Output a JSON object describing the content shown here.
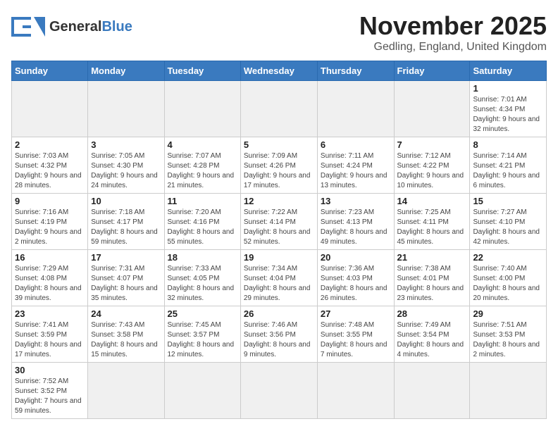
{
  "header": {
    "logo_general": "General",
    "logo_blue": "Blue",
    "month_title": "November 2025",
    "location": "Gedling, England, United Kingdom"
  },
  "weekdays": [
    "Sunday",
    "Monday",
    "Tuesday",
    "Wednesday",
    "Thursday",
    "Friday",
    "Saturday"
  ],
  "weeks": [
    [
      {
        "day": "",
        "info": ""
      },
      {
        "day": "",
        "info": ""
      },
      {
        "day": "",
        "info": ""
      },
      {
        "day": "",
        "info": ""
      },
      {
        "day": "",
        "info": ""
      },
      {
        "day": "",
        "info": ""
      },
      {
        "day": "1",
        "info": "Sunrise: 7:01 AM\nSunset: 4:34 PM\nDaylight: 9 hours and 32 minutes."
      }
    ],
    [
      {
        "day": "2",
        "info": "Sunrise: 7:03 AM\nSunset: 4:32 PM\nDaylight: 9 hours and 28 minutes."
      },
      {
        "day": "3",
        "info": "Sunrise: 7:05 AM\nSunset: 4:30 PM\nDaylight: 9 hours and 24 minutes."
      },
      {
        "day": "4",
        "info": "Sunrise: 7:07 AM\nSunset: 4:28 PM\nDaylight: 9 hours and 21 minutes."
      },
      {
        "day": "5",
        "info": "Sunrise: 7:09 AM\nSunset: 4:26 PM\nDaylight: 9 hours and 17 minutes."
      },
      {
        "day": "6",
        "info": "Sunrise: 7:11 AM\nSunset: 4:24 PM\nDaylight: 9 hours and 13 minutes."
      },
      {
        "day": "7",
        "info": "Sunrise: 7:12 AM\nSunset: 4:22 PM\nDaylight: 9 hours and 10 minutes."
      },
      {
        "day": "8",
        "info": "Sunrise: 7:14 AM\nSunset: 4:21 PM\nDaylight: 9 hours and 6 minutes."
      }
    ],
    [
      {
        "day": "9",
        "info": "Sunrise: 7:16 AM\nSunset: 4:19 PM\nDaylight: 9 hours and 2 minutes."
      },
      {
        "day": "10",
        "info": "Sunrise: 7:18 AM\nSunset: 4:17 PM\nDaylight: 8 hours and 59 minutes."
      },
      {
        "day": "11",
        "info": "Sunrise: 7:20 AM\nSunset: 4:16 PM\nDaylight: 8 hours and 55 minutes."
      },
      {
        "day": "12",
        "info": "Sunrise: 7:22 AM\nSunset: 4:14 PM\nDaylight: 8 hours and 52 minutes."
      },
      {
        "day": "13",
        "info": "Sunrise: 7:23 AM\nSunset: 4:13 PM\nDaylight: 8 hours and 49 minutes."
      },
      {
        "day": "14",
        "info": "Sunrise: 7:25 AM\nSunset: 4:11 PM\nDaylight: 8 hours and 45 minutes."
      },
      {
        "day": "15",
        "info": "Sunrise: 7:27 AM\nSunset: 4:10 PM\nDaylight: 8 hours and 42 minutes."
      }
    ],
    [
      {
        "day": "16",
        "info": "Sunrise: 7:29 AM\nSunset: 4:08 PM\nDaylight: 8 hours and 39 minutes."
      },
      {
        "day": "17",
        "info": "Sunrise: 7:31 AM\nSunset: 4:07 PM\nDaylight: 8 hours and 35 minutes."
      },
      {
        "day": "18",
        "info": "Sunrise: 7:33 AM\nSunset: 4:05 PM\nDaylight: 8 hours and 32 minutes."
      },
      {
        "day": "19",
        "info": "Sunrise: 7:34 AM\nSunset: 4:04 PM\nDaylight: 8 hours and 29 minutes."
      },
      {
        "day": "20",
        "info": "Sunrise: 7:36 AM\nSunset: 4:03 PM\nDaylight: 8 hours and 26 minutes."
      },
      {
        "day": "21",
        "info": "Sunrise: 7:38 AM\nSunset: 4:01 PM\nDaylight: 8 hours and 23 minutes."
      },
      {
        "day": "22",
        "info": "Sunrise: 7:40 AM\nSunset: 4:00 PM\nDaylight: 8 hours and 20 minutes."
      }
    ],
    [
      {
        "day": "23",
        "info": "Sunrise: 7:41 AM\nSunset: 3:59 PM\nDaylight: 8 hours and 17 minutes."
      },
      {
        "day": "24",
        "info": "Sunrise: 7:43 AM\nSunset: 3:58 PM\nDaylight: 8 hours and 15 minutes."
      },
      {
        "day": "25",
        "info": "Sunrise: 7:45 AM\nSunset: 3:57 PM\nDaylight: 8 hours and 12 minutes."
      },
      {
        "day": "26",
        "info": "Sunrise: 7:46 AM\nSunset: 3:56 PM\nDaylight: 8 hours and 9 minutes."
      },
      {
        "day": "27",
        "info": "Sunrise: 7:48 AM\nSunset: 3:55 PM\nDaylight: 8 hours and 7 minutes."
      },
      {
        "day": "28",
        "info": "Sunrise: 7:49 AM\nSunset: 3:54 PM\nDaylight: 8 hours and 4 minutes."
      },
      {
        "day": "29",
        "info": "Sunrise: 7:51 AM\nSunset: 3:53 PM\nDaylight: 8 hours and 2 minutes."
      }
    ],
    [
      {
        "day": "30",
        "info": "Sunrise: 7:52 AM\nSunset: 3:52 PM\nDaylight: 7 hours and 59 minutes."
      },
      {
        "day": "",
        "info": ""
      },
      {
        "day": "",
        "info": ""
      },
      {
        "day": "",
        "info": ""
      },
      {
        "day": "",
        "info": ""
      },
      {
        "day": "",
        "info": ""
      },
      {
        "day": "",
        "info": ""
      }
    ]
  ]
}
